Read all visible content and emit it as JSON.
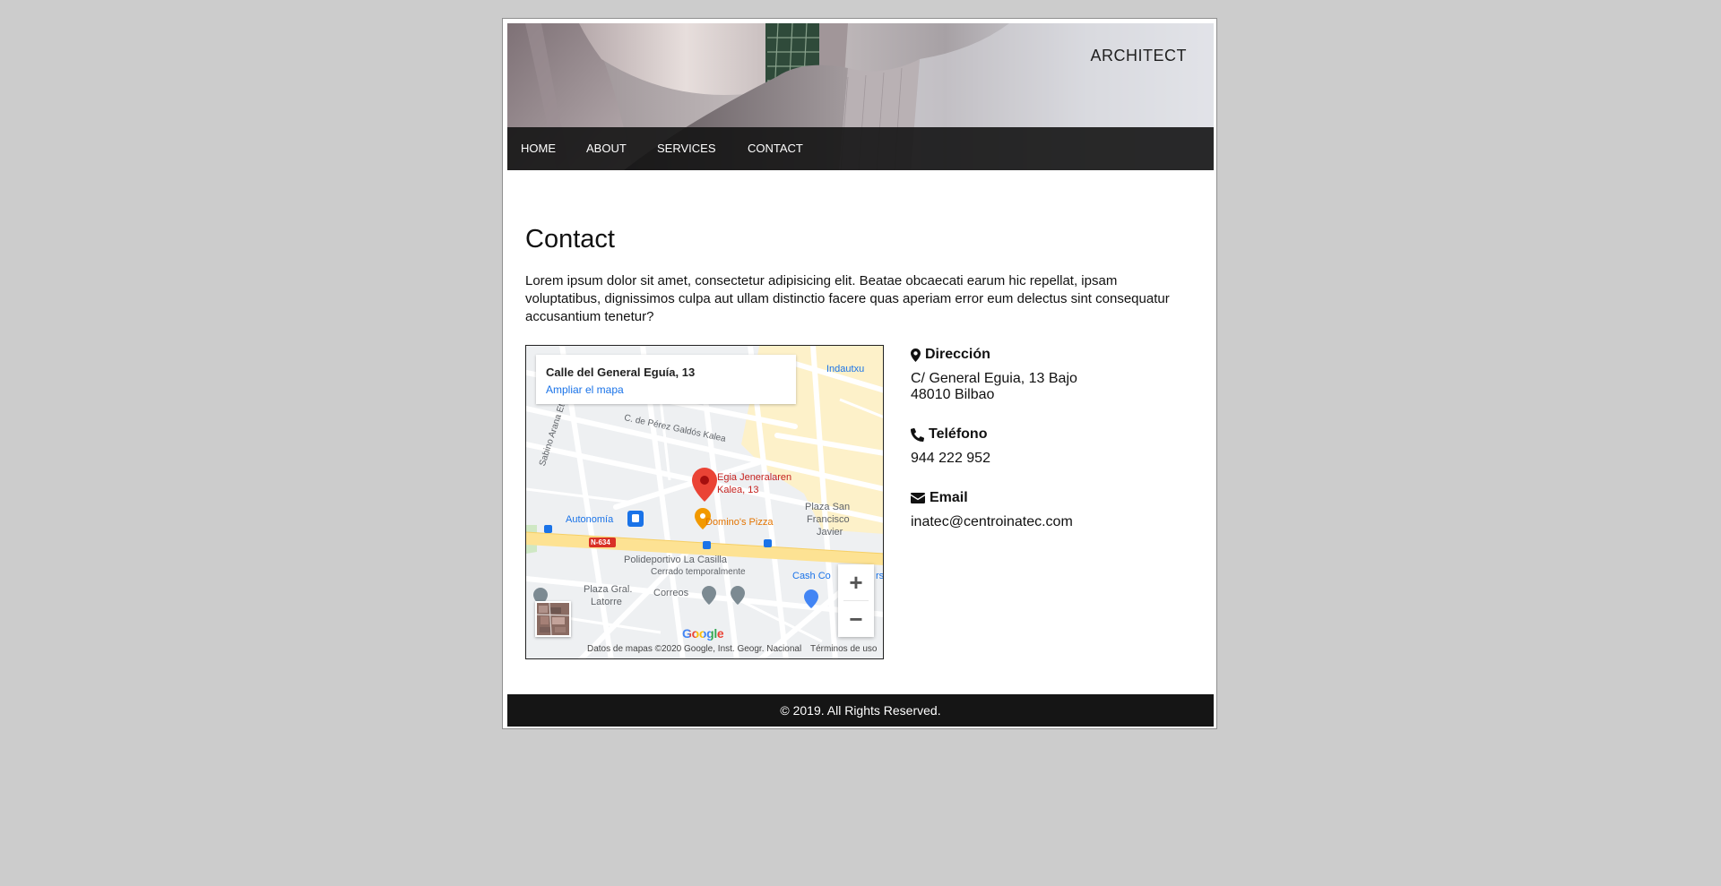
{
  "header": {
    "brand": "ARCHITECT"
  },
  "nav": {
    "items": [
      {
        "label": "HOME"
      },
      {
        "label": "ABOUT"
      },
      {
        "label": "SERVICES"
      },
      {
        "label": "CONTACT"
      }
    ]
  },
  "main": {
    "title": "Contact",
    "intro": "Lorem ipsum dolor sit amet, consectetur adipisicing elit. Beatae obcaecati earum hic repellat, ipsam voluptatibus, dignissimos culpa aut ullam distinctio facere quas aperiam error eum delectus sint consequatur accusantium tenetur?"
  },
  "map": {
    "card_address": "Calle del General Eguía, 13",
    "card_link": "Ampliar el mapa",
    "labels": {
      "indautxu": "Indautxu",
      "street_perez_galdos": "C. de Pérez Galdós Kalea",
      "street_sabino_arana": "Sabino Arana Etorbidea",
      "pin_line1": "Egia Jeneralaren",
      "pin_line2": "Kalea, 13",
      "autonomia": "Autonomía",
      "dominos": "Domino's Pizza",
      "plaza_san_francisco_1": "Plaza San",
      "plaza_san_francisco_2": "Francisco",
      "plaza_san_francisco_3": "Javier",
      "road_badge": "N-634",
      "polideportivo": "Polideportivo La Casilla",
      "cerrado": "Cerrado temporalmente",
      "plaza_gral_1": "Plaza Gral.",
      "plaza_gral_2": "Latorre",
      "correos": "Correos",
      "cash_co": "Cash Co",
      "cash_rs": "rs"
    },
    "google": "Google",
    "attribution": "Datos de mapas ©2020 Google, Inst. Geogr. Nacional",
    "terms": "Términos de uso",
    "zoom_in": "+",
    "zoom_out": "−",
    "colors": {
      "pin": "#ea4335",
      "highlight_area": "#fdf1c9",
      "main_road": "#fde293",
      "pin_label": "#c5221f",
      "poi_orange": "#f29900",
      "transit_blue": "#1a73e8"
    }
  },
  "contact": {
    "address": {
      "icon": "map-marker-icon",
      "heading": "Dirección",
      "line1": "C/ General Eguia, 13 Bajo",
      "line2": "48010 Bilbao"
    },
    "phone": {
      "icon": "phone-icon",
      "heading": "Teléfono",
      "value": "944 222 952"
    },
    "email": {
      "icon": "envelope-icon",
      "heading": "Email",
      "value": "inatec@centroinatec.com"
    }
  },
  "footer": {
    "text": "© 2019. All Rights Reserved."
  }
}
